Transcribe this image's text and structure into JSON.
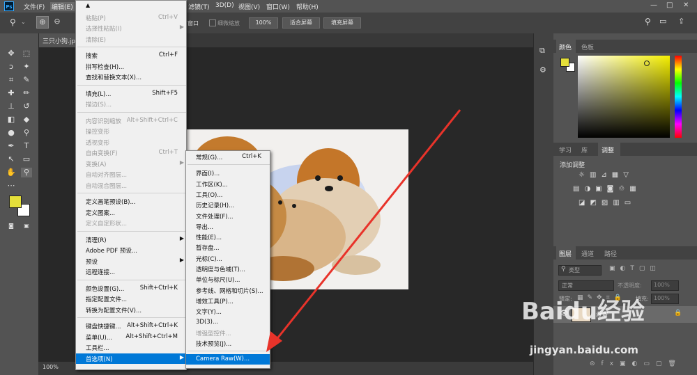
{
  "app": {
    "logo": "Ps"
  },
  "menubar": {
    "items": [
      "文件(F)",
      "编辑(E)",
      "滤镜(T)",
      "3D(D)",
      "视图(V)",
      "窗口(W)",
      "帮助(H)"
    ],
    "window_controls": [
      "—",
      "□",
      "✕"
    ]
  },
  "optionsbar": {
    "window_label": "窗口",
    "scrubby_label": "细微缩放",
    "zoom_value": "100%",
    "fit_button": "适合屏幕",
    "fill_button": "填充屏幕"
  },
  "document": {
    "tab_title": "三只小狗.jp",
    "zoom_status": "100%"
  },
  "edit_menu": {
    "items": [
      {
        "label": "",
        "shortcut": "",
        "disabled": false
      },
      {
        "label": "粘贴(P)",
        "shortcut": "Ctrl+V",
        "disabled": true
      },
      {
        "label": "选择性粘贴(I)",
        "shortcut": "",
        "disabled": true,
        "submenu": true
      },
      {
        "label": "清除(E)",
        "shortcut": "",
        "disabled": true
      },
      {
        "label": "搜索",
        "shortcut": "Ctrl+F",
        "disabled": false
      },
      {
        "label": "拼写检查(H)...",
        "shortcut": "",
        "disabled": false
      },
      {
        "label": "查找和替换文本(X)...",
        "shortcut": "",
        "disabled": false
      },
      {
        "label": "填充(L)...",
        "shortcut": "Shift+F5",
        "disabled": false
      },
      {
        "label": "描边(S)...",
        "shortcut": "",
        "disabled": true
      },
      {
        "label": "内容识别缩放",
        "shortcut": "Alt+Shift+Ctrl+C",
        "disabled": true
      },
      {
        "label": "操控变形",
        "shortcut": "",
        "disabled": true
      },
      {
        "label": "透视变形",
        "shortcut": "",
        "disabled": true
      },
      {
        "label": "自由变换(F)",
        "shortcut": "Ctrl+T",
        "disabled": true
      },
      {
        "label": "变换(A)",
        "shortcut": "",
        "disabled": true,
        "submenu": true
      },
      {
        "label": "自动对齐图层...",
        "shortcut": "",
        "disabled": true
      },
      {
        "label": "自动混合图层...",
        "shortcut": "",
        "disabled": true
      },
      {
        "label": "定义画笔预设(B)...",
        "shortcut": "",
        "disabled": false
      },
      {
        "label": "定义图案...",
        "shortcut": "",
        "disabled": false
      },
      {
        "label": "定义自定形状...",
        "shortcut": "",
        "disabled": true
      },
      {
        "label": "清理(R)",
        "shortcut": "",
        "disabled": false,
        "submenu": true
      },
      {
        "label": "Adobe PDF 预设...",
        "shortcut": "",
        "disabled": false
      },
      {
        "label": "预设",
        "shortcut": "",
        "disabled": false,
        "submenu": true
      },
      {
        "label": "远程连接...",
        "shortcut": "",
        "disabled": false
      },
      {
        "label": "颜色设置(G)...",
        "shortcut": "Shift+Ctrl+K",
        "disabled": false
      },
      {
        "label": "指定配置文件...",
        "shortcut": "",
        "disabled": false
      },
      {
        "label": "转换为配置文件(V)...",
        "shortcut": "",
        "disabled": false
      },
      {
        "label": "键盘快捷键...",
        "shortcut": "Alt+Shift+Ctrl+K",
        "disabled": false
      },
      {
        "label": "菜单(U)...",
        "shortcut": "Alt+Shift+Ctrl+M",
        "disabled": false
      },
      {
        "label": "工具栏...",
        "shortcut": "",
        "disabled": false
      },
      {
        "label": "首选项(N)",
        "shortcut": "",
        "disabled": false,
        "submenu": true,
        "highlighted": true
      }
    ]
  },
  "prefs_menu": {
    "items": [
      {
        "label": "常规(G)...",
        "shortcut": "Ctrl+K",
        "disabled": false
      },
      {
        "label": "界面(I)...",
        "shortcut": "",
        "disabled": false
      },
      {
        "label": "工作区(K)...",
        "shortcut": "",
        "disabled": false
      },
      {
        "label": "工具(O)...",
        "shortcut": "",
        "disabled": false
      },
      {
        "label": "历史记录(H)...",
        "shortcut": "",
        "disabled": false
      },
      {
        "label": "文件处理(F)...",
        "shortcut": "",
        "disabled": false
      },
      {
        "label": "导出...",
        "shortcut": "",
        "disabled": false
      },
      {
        "label": "性能(E)...",
        "shortcut": "",
        "disabled": false
      },
      {
        "label": "暂存盘...",
        "shortcut": "",
        "disabled": false
      },
      {
        "label": "光标(C)...",
        "shortcut": "",
        "disabled": false
      },
      {
        "label": "透明度与色域(T)...",
        "shortcut": "",
        "disabled": false
      },
      {
        "label": "单位与标尺(U)...",
        "shortcut": "",
        "disabled": false
      },
      {
        "label": "参考线、网格和切片(S)...",
        "shortcut": "",
        "disabled": false
      },
      {
        "label": "增效工具(P)...",
        "shortcut": "",
        "disabled": false
      },
      {
        "label": "文字(Y)...",
        "shortcut": "",
        "disabled": false
      },
      {
        "label": "3D(3)...",
        "shortcut": "",
        "disabled": false
      },
      {
        "label": "增强型控件...",
        "shortcut": "",
        "disabled": true
      },
      {
        "label": "技术预览(J)...",
        "shortcut": "",
        "disabled": false
      },
      {
        "label": "Camera Raw(W)...",
        "shortcut": "",
        "disabled": false,
        "highlighted": true
      }
    ]
  },
  "panels": {
    "color_tabs": [
      "颜色",
      "色板"
    ],
    "adjust_tabs": [
      "学习",
      "库",
      "调整"
    ],
    "adjust_title": "添加调整",
    "layer_tabs": [
      "图层",
      "通道",
      "路径"
    ],
    "layer_filter": "类型",
    "blend_mode": "正常",
    "opacity_label": "不透明度:",
    "opacity_value": "100%",
    "lock_label": "锁定:",
    "fill_label": "填充:",
    "fill_value": "100%",
    "layer_name": "背景"
  },
  "watermark": {
    "brand": "Baidu经验",
    "url": "jingyan.baidu.com"
  },
  "colors": {
    "foreground": "#e5e03a",
    "background": "#ffffff",
    "menu_highlight": "#0078d7",
    "arrow": "#e8332a"
  }
}
